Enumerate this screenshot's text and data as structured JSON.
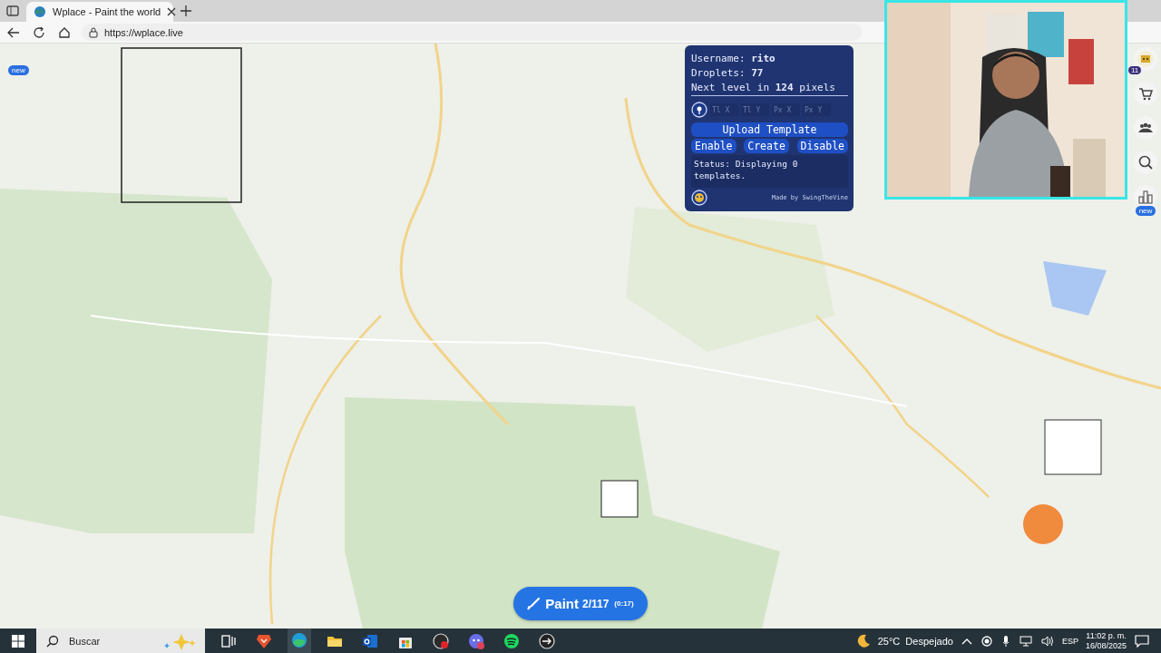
{
  "browser": {
    "tabs": [
      {
        "title": "Wplace - Paint the world",
        "selected": true
      }
    ],
    "url": "https://wplace.live"
  },
  "map": {
    "kind": "picture",
    "left_badge": "new"
  },
  "template_panel": {
    "info_lines": [
      "Username: **rito**",
      "Droplets: **77**",
      "Next level in **124** pixels"
    ],
    "coordinate_fields": [
      {
        "placeholder": "Tl X"
      },
      {
        "placeholder": "Tl Y"
      },
      {
        "placeholder": "Px X"
      },
      {
        "placeholder": "Px Y"
      }
    ],
    "upload_button": "Upload Template",
    "action_buttons": [
      "Enable",
      "Create",
      "Disable"
    ],
    "status": "Status: Displaying 0 templates.",
    "credit": "Made by SwingTheVine"
  },
  "paint_button": {
    "label": "Paint",
    "count": "2/117",
    "timer": "(0:17)"
  },
  "side_rail": {
    "items": [
      {
        "kind": "avatar",
        "badge": "11"
      },
      {
        "kind": "store"
      },
      {
        "kind": "people"
      },
      {
        "kind": "search"
      },
      {
        "kind": "leaderboard",
        "badge": "new"
      }
    ]
  },
  "taskbar": {
    "search_placeholder": "Buscar",
    "apps": [
      {
        "kind": "taskview",
        "selected": false
      },
      {
        "kind": "brave",
        "selected": false
      },
      {
        "kind": "edge",
        "selected": true
      },
      {
        "kind": "folder",
        "selected": false
      },
      {
        "kind": "outlook",
        "selected": false
      },
      {
        "kind": "store",
        "selected": false
      },
      {
        "kind": "obs",
        "selected": false
      },
      {
        "kind": "discord",
        "selected": false
      },
      {
        "kind": "spotify",
        "selected": false
      },
      {
        "kind": "arrow",
        "selected": false
      }
    ],
    "weather": "25°C  Despejado",
    "language": "ESP",
    "time": "11:02 p. m.",
    "date": "16/08/2025"
  }
}
